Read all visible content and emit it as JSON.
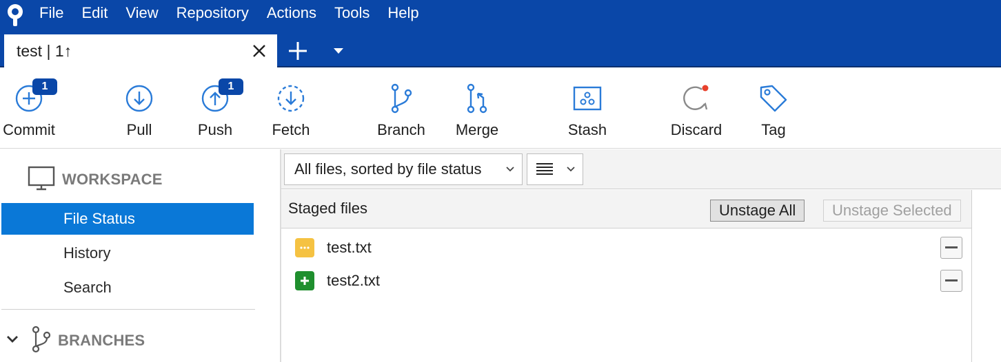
{
  "menu": {
    "items": [
      "File",
      "Edit",
      "View",
      "Repository",
      "Actions",
      "Tools",
      "Help"
    ]
  },
  "tabs": {
    "active_label": "test | 1↑"
  },
  "toolbar": {
    "commit_label": "Commit",
    "commit_badge": "1",
    "pull_label": "Pull",
    "push_label": "Push",
    "push_badge": "1",
    "fetch_label": "Fetch",
    "branch_label": "Branch",
    "merge_label": "Merge",
    "stash_label": "Stash",
    "discard_label": "Discard",
    "tag_label": "Tag"
  },
  "sidebar": {
    "workspace_title": "WORKSPACE",
    "items": [
      "File Status",
      "History",
      "Search"
    ],
    "branches_title": "BRANCHES"
  },
  "filter": {
    "selected": "All files, sorted by file status"
  },
  "staged": {
    "title": "Staged files",
    "unstage_all_label": "Unstage All",
    "unstage_selected_label": "Unstage Selected",
    "files": [
      {
        "name": "test.txt",
        "status": "modified"
      },
      {
        "name": "test2.txt",
        "status": "added"
      }
    ]
  },
  "colors": {
    "brand_blue": "#0a47a8",
    "selection_blue": "#0a78d7",
    "modified_yellow": "#f5c242",
    "added_green": "#1f8f2e",
    "discard_red": "#e8412c"
  }
}
